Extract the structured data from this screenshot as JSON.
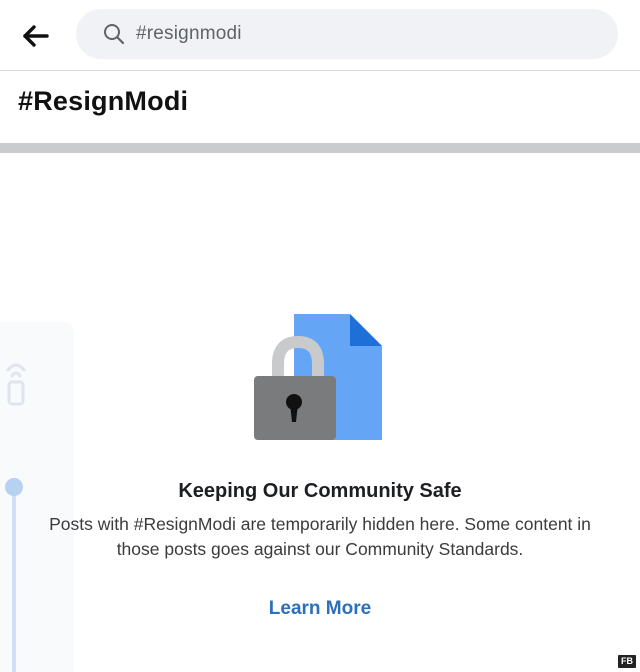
{
  "header": {
    "back_icon": "arrow-left-icon",
    "search": {
      "icon": "search-icon",
      "query": "#resignmodi"
    }
  },
  "hashtag": {
    "title": "#ResignModi"
  },
  "notice": {
    "illustration_icon": "locked-document-icon",
    "headline": "Keeping Our Community Safe",
    "body": "Posts with #ResignModi are temporarily hidden here. Some content in those posts goes against our Community Standards.",
    "link_label": "Learn More"
  },
  "watermark": {
    "text": "FB"
  },
  "colors": {
    "link": "#2d6fb8",
    "search_bg": "#f0f2f5",
    "divider": "#c9cccf",
    "document_blue": "#64a6f5",
    "lock_grey": "#7a7b7d"
  }
}
